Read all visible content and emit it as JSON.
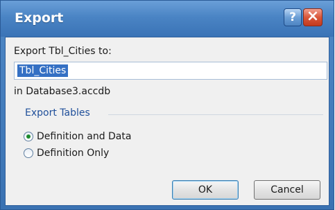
{
  "dialog": {
    "title": "Export",
    "help_glyph": "?",
    "close_glyph": "×"
  },
  "form": {
    "export_label": "Export Tbl_Cities to:",
    "name_value": "Tbl_Cities",
    "location_label": "in Database3.accdb"
  },
  "export_tables": {
    "group_title": "Export Tables",
    "options": [
      {
        "label": "Definition and Data",
        "checked": true
      },
      {
        "label": "Definition Only",
        "checked": false
      }
    ]
  },
  "buttons": {
    "ok_label": "OK",
    "cancel_label": "Cancel"
  },
  "colors": {
    "title_bar": "#4a84c4",
    "selection": "#3470c4",
    "group_title": "#1f4f9a",
    "close_button": "#d9573a"
  },
  "icons": {
    "help": "help-icon",
    "close": "close-icon",
    "radio_selected": "radio-selected-icon",
    "radio_unselected": "radio-unselected-icon"
  }
}
